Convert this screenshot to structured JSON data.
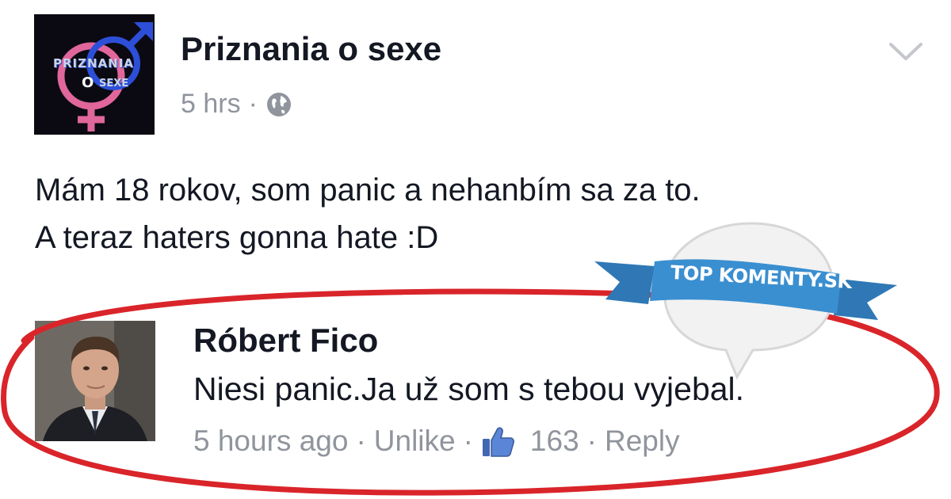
{
  "post": {
    "page_name": "Priznania o sexe",
    "time": "5 hrs",
    "meta_separator": "·",
    "privacy_icon": "globe-icon",
    "text_lines": [
      "Mám 18 rokov, som panic a nehanbím sa za to.",
      "A teraz haters gonna hate :D"
    ],
    "avatar": {
      "line1": "PRIZNANIA",
      "line2": "O",
      "line3": "SEXE"
    }
  },
  "comment": {
    "author": "Róbert Fico",
    "text": "Niesi panic.Ja už som s tebou vyjebal.",
    "time": "5 hours ago",
    "unlike_label": "Unlike",
    "like_count": "163",
    "reply_label": "Reply",
    "separator": "·"
  },
  "watermark": {
    "label": "TOP KOMENTY.SK",
    "ribbon_color": "#3a8fd0",
    "bubble_color": "#f4f4f4"
  },
  "colors": {
    "highlight_ellipse": "#d9252a",
    "text_primary": "#141823",
    "text_secondary": "#90949c",
    "like_blue": "#4267b2"
  }
}
